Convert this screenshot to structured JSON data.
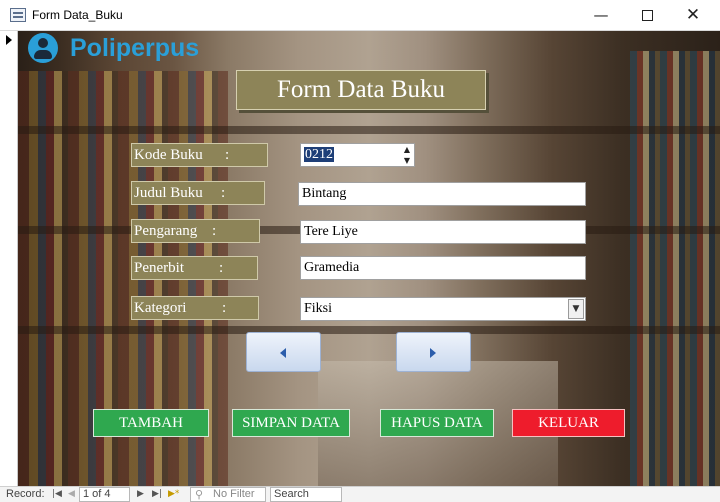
{
  "window": {
    "title": "Form Data_Buku",
    "minimize": "—",
    "close": "✕"
  },
  "logo": {
    "text": "Poliperpus"
  },
  "form": {
    "title": "Form Data Buku",
    "fields": {
      "kode_label": "Kode Buku",
      "kode_value": "0212",
      "judul_label": "Judul Buku",
      "judul_value": "Bintang",
      "pengarang_label": "Pengarang",
      "pengarang_value": "Tere Liye",
      "penerbit_label": "Penerbit",
      "penerbit_value": "Gramedia",
      "kategori_label": "Kategori",
      "kategori_value": "Fiksi"
    },
    "colon": ":",
    "spin_up": "▲",
    "spin_down": "▼",
    "combo_arrow": "▼"
  },
  "buttons": {
    "tambah": "TAMBAH",
    "simpan": "SIMPAN DATA",
    "hapus": "HAPUS DATA",
    "keluar": "KELUAR"
  },
  "statusbar": {
    "record_label": "Record:",
    "first": "|◀",
    "prev": "◀",
    "position": "1 of 4",
    "next": "▶",
    "last": "▶|",
    "new": "▶*",
    "filter": "No Filter",
    "search": "Search"
  },
  "colors": {
    "label_bg": "#8d8458",
    "green_button": "#2fa84f",
    "red_button": "#ee1c2c",
    "logo_blue": "#2a9fd8"
  }
}
